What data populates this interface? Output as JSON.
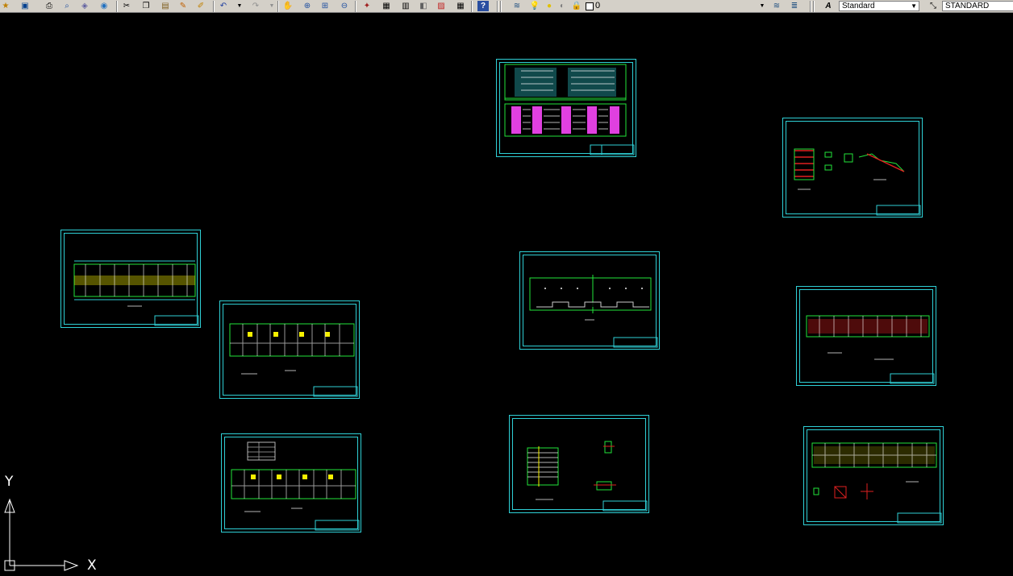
{
  "toolbar": {
    "text_style": "Standard",
    "dim_style": "STANDARD",
    "layer": "0",
    "icons": [
      "new-icon",
      "save-icon",
      "print-icon",
      "print-preview-icon",
      "publish-icon",
      "plot-icon",
      "cut-icon",
      "copy-icon",
      "paste-icon",
      "match-properties-icon",
      "block-editor-icon",
      "undo-icon",
      "redo-icon",
      "pan-icon",
      "zoom-realtime-icon",
      "zoom-window-icon",
      "zoom-previous-icon",
      "properties-icon",
      "design-center-icon",
      "tool-palettes-icon",
      "sheet-set-icon",
      "markup-icon",
      "calculator-icon",
      "help-icon",
      "layer-manager-icon",
      "layer-on-icon",
      "layer-freeze-icon",
      "layer-lock-icon",
      "layer-color-icon",
      "text-style-icon",
      "dim-style-icon"
    ]
  },
  "ucs": {
    "y_label": "Y",
    "x_label": "X"
  },
  "colors": {
    "frame": "#2fd0d6",
    "green": "#22e33a",
    "yellow": "#f6f000",
    "magenta": "#e040e0",
    "red": "#e02020",
    "white": "#ffffff"
  }
}
